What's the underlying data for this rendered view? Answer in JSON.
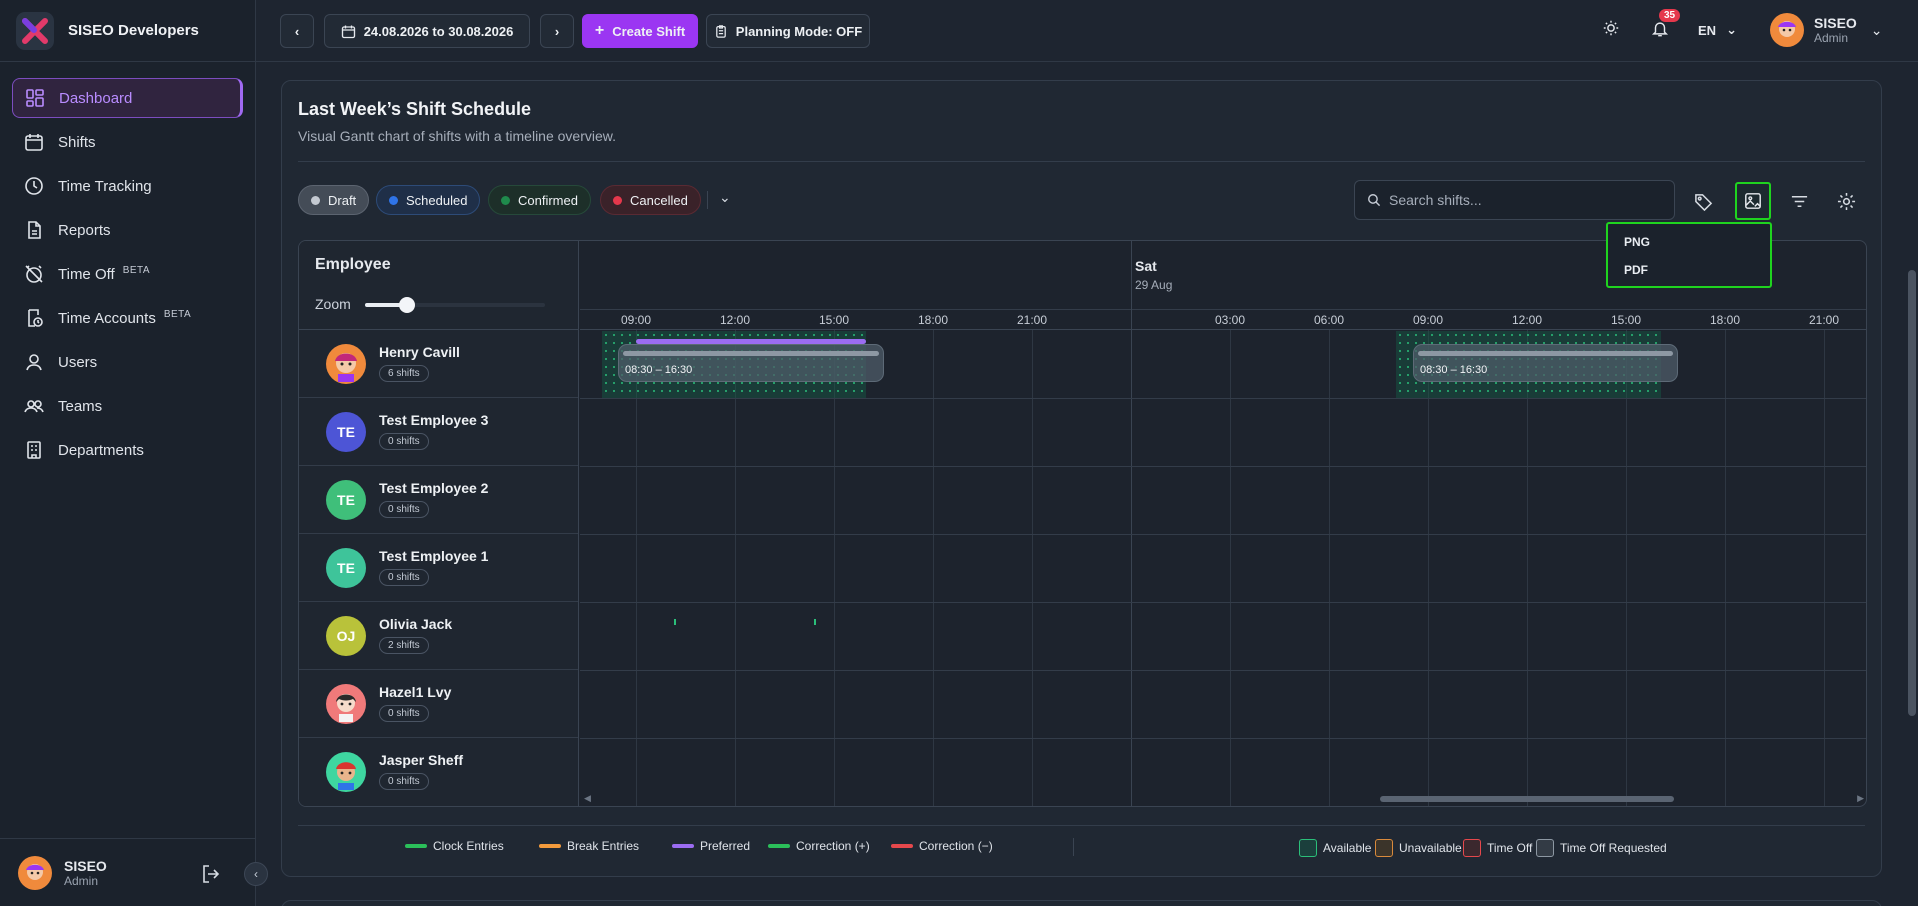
{
  "brand": {
    "name": "SISEO Developers"
  },
  "sidebar": {
    "items": [
      {
        "label": "Dashboard",
        "icon": "dashboard-icon",
        "active": true
      },
      {
        "label": "Shifts",
        "icon": "calendar-icon"
      },
      {
        "label": "Time Tracking",
        "icon": "clock-icon"
      },
      {
        "label": "Reports",
        "icon": "report-icon"
      },
      {
        "label": "Time Off",
        "icon": "alarm-off-icon",
        "badge": "BETA"
      },
      {
        "label": "Time Accounts",
        "icon": "time-account-icon",
        "badge": "BETA"
      },
      {
        "label": "Users",
        "icon": "user-icon"
      },
      {
        "label": "Teams",
        "icon": "teams-icon"
      },
      {
        "label": "Departments",
        "icon": "building-icon"
      }
    ],
    "footer": {
      "name": "SISEO",
      "role": "Admin"
    }
  },
  "header": {
    "date_range": "24.08.2026 to 30.08.2026",
    "create_shift": "Create Shift",
    "planning_mode": "Planning Mode: OFF",
    "notifications_count": "35",
    "language": "EN",
    "user": {
      "name": "SISEO",
      "role": "Admin"
    }
  },
  "card": {
    "title": "Last Week’s Shift Schedule",
    "subtitle": "Visual Gantt chart of shifts with a timeline overview.",
    "filters": [
      {
        "label": "Draft",
        "color": "#c4c9d1"
      },
      {
        "label": "Scheduled",
        "color": "#2f74e8"
      },
      {
        "label": "Confirmed",
        "color": "#1f8a4c"
      },
      {
        "label": "Cancelled",
        "color": "#e5384c"
      }
    ],
    "search_placeholder": "Search shifts...",
    "export_menu": [
      "PNG",
      "PDF"
    ]
  },
  "gantt": {
    "employee_header": "Employee",
    "zoom_label": "Zoom",
    "zoom_value": 0.28,
    "days": [
      {
        "label": "Sat",
        "date": "29 Aug"
      }
    ],
    "hour_ticks_day1": [
      "09:00",
      "12:00",
      "15:00",
      "18:00",
      "21:00"
    ],
    "hour_ticks_day2": [
      "03:00",
      "06:00",
      "09:00",
      "12:00",
      "15:00",
      "18:00",
      "21:00"
    ],
    "employees": [
      {
        "name": "Henry Cavill",
        "shifts": "6 shifts",
        "initials": "",
        "color": "#f08a3c"
      },
      {
        "name": "Test Employee 3",
        "shifts": "0 shifts",
        "initials": "TE",
        "color": "#4d55d6"
      },
      {
        "name": "Test Employee 2",
        "shifts": "0 shifts",
        "initials": "TE",
        "color": "#3fbf7a"
      },
      {
        "name": "Test Employee 1",
        "shifts": "0 shifts",
        "initials": "TE",
        "color": "#3ec49a"
      },
      {
        "name": "Olivia Jack",
        "shifts": "2 shifts",
        "initials": "OJ",
        "color": "#b9c23a"
      },
      {
        "name": "Hazel1 Lvy",
        "shifts": "0 shifts",
        "initials": "",
        "color": "#f07a7a"
      },
      {
        "name": "Jasper Sheff",
        "shifts": "0 shifts",
        "initials": "",
        "color": "#3ed6a0"
      }
    ],
    "shift_blocks": [
      {
        "label": "08:30 – 16:30"
      },
      {
        "label": "08:30 – 16:30"
      }
    ]
  },
  "legend": {
    "lines": [
      {
        "label": "Clock Entries",
        "color": "#2bbf5a"
      },
      {
        "label": "Break Entries",
        "color": "#f29a3c"
      },
      {
        "label": "Preferred",
        "color": "#9b6cf2"
      },
      {
        "label": "Correction (+)",
        "color": "#2bbf5a"
      },
      {
        "label": "Correction (−)",
        "color": "#e5484c"
      }
    ],
    "boxes": [
      {
        "label": "Available",
        "color": "#2bbf7a"
      },
      {
        "label": "Unavailable",
        "color": "#d98a3c"
      },
      {
        "label": "Time Off",
        "color": "#e5484c"
      },
      {
        "label": "Time Off Requested",
        "color": "#8d98a3"
      }
    ]
  }
}
